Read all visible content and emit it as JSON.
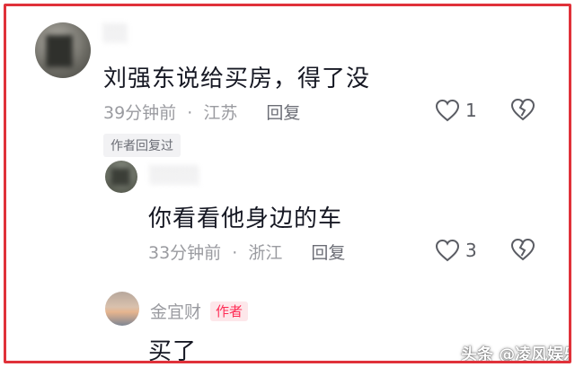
{
  "comments": [
    {
      "username": "░░",
      "text": "刘强东说给买房，得了没",
      "time": "39分钟前",
      "location": "江苏",
      "reply_label": "回复",
      "like_count": "1",
      "author_replied_tag": "作者回复过"
    }
  ],
  "replies": [
    {
      "username": "░░░░",
      "text": "你看看他身边的车",
      "time": "33分钟前",
      "location": "浙江",
      "reply_label": "回复",
      "like_count": "3"
    },
    {
      "username": "金宜财",
      "author_badge": "作者",
      "text": "买了"
    }
  ],
  "separator": "·",
  "watermark": "头条 @凌风娱乐",
  "colors": {
    "frame": "#e0323a",
    "author_badge_bg": "#fde7ea",
    "author_badge_text": "#fe2c55",
    "muted": "#9a9ba0"
  },
  "icons": [
    "heart-icon",
    "broken-heart-icon"
  ]
}
